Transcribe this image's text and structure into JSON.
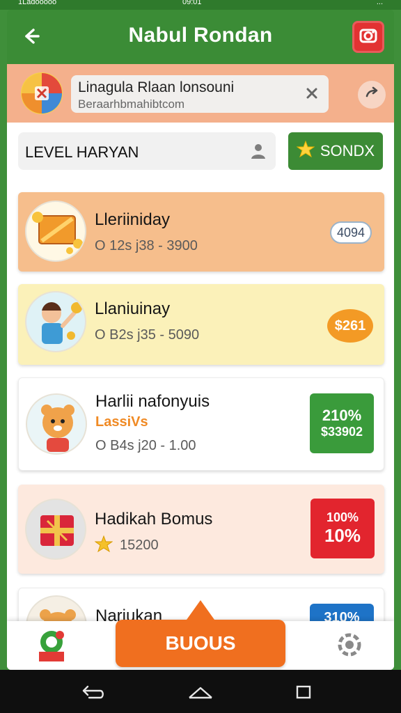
{
  "status_bar": {
    "left": "1Ladooooo",
    "mid": "09:01",
    "right": "..."
  },
  "header": {
    "title": "Nabul Rondan"
  },
  "banner": {
    "search_line1": "Linagula Rlaan lonsouni",
    "search_line2": "Beraarhbmahibtcom"
  },
  "filters": {
    "level_value": "LEVEL HARYAN",
    "sort_label": "SONDX"
  },
  "list": [
    {
      "title": "Lleriiniday",
      "subtitle": "",
      "meta": "O 12s j38 - 3900",
      "badge_text": "4094",
      "badge_type": "cloud",
      "bg": "#f6be8c"
    },
    {
      "title": "Llaniuinay",
      "subtitle": "",
      "meta": "O B2s j35 - 5090",
      "badge_text": "$261",
      "badge_type": "sun",
      "bg": "#fbf1b9"
    },
    {
      "title": "Harlii nafonyuis",
      "subtitle": "LassiVs",
      "meta": "O B4s j20 - 1.00",
      "badge_line1": "210%",
      "badge_line2": "$33902",
      "badge_type": "green",
      "bg": "#ffffff"
    },
    {
      "title": "Hadikah Bomus",
      "subtitle": "",
      "meta": "15200",
      "badge_line1": "100%",
      "badge_line2": "10%",
      "badge_type": "red",
      "bg": "#fde9de"
    },
    {
      "title": "Nariukan",
      "subtitle": "",
      "meta": "",
      "badge_line1": "310%",
      "badge_line2": "",
      "badge_type": "blue",
      "bg": "#ffffff"
    }
  ],
  "bottom_nav": {
    "bonus_label": "BUOUS"
  },
  "colors": {
    "primary_green": "#3b8c36",
    "accent_orange": "#f06f1f",
    "banner_peach": "#f4b08c",
    "red": "#e23232"
  }
}
